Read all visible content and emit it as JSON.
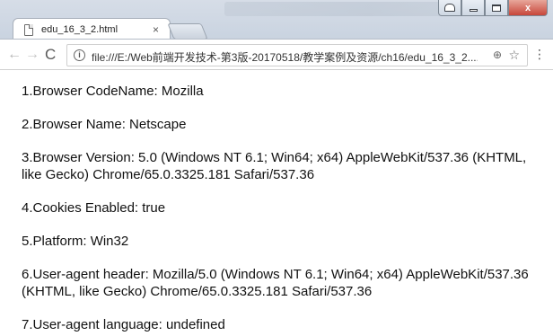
{
  "window": {
    "tab_title": "edu_16_3_2.html",
    "tab_close": "×",
    "close_glyph": "x"
  },
  "toolbar": {
    "back_glyph": "←",
    "forward_glyph": "→",
    "reload_glyph": "C",
    "info_glyph": "i",
    "url": "file:///E:/Web前端开发技术-第3版-20170518/教学案例及资源/ch16/edu_16_3_2....",
    "zoom_glyph": "⊕",
    "star_glyph": "☆",
    "menu_glyph": "⋮"
  },
  "page": {
    "lines": [
      "1.Browser CodeName: Mozilla",
      "2.Browser Name: Netscape",
      "3.Browser Version: 5.0 (Windows NT 6.1; Win64; x64) AppleWebKit/537.36 (KHTML, like Gecko) Chrome/65.0.3325.181 Safari/537.36",
      "4.Cookies Enabled: true",
      "5.Platform: Win32",
      "6.User-agent header: Mozilla/5.0 (Windows NT 6.1; Win64; x64) AppleWebKit/537.36 (KHTML, like Gecko) Chrome/65.0.3325.181 Safari/537.36",
      "7.User-agent language: undefined"
    ]
  }
}
